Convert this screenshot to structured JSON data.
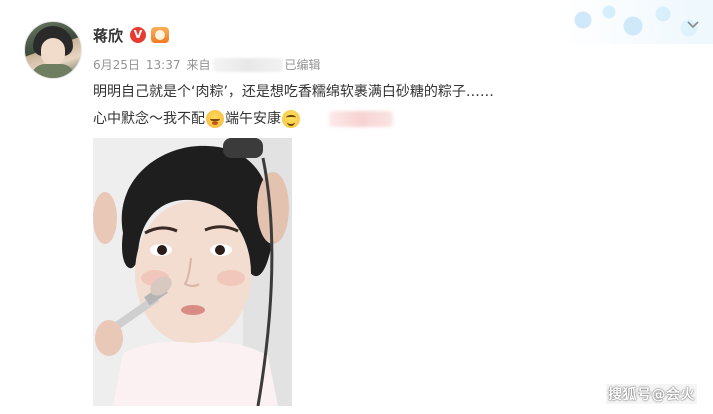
{
  "post": {
    "author": {
      "name": "蒋欣",
      "avatar_icon": "avatar-photo",
      "verified_badge": "V",
      "verified_icon": "verified-v-icon",
      "member_icon": "member-crown-icon"
    },
    "meta": {
      "date": "6月25日",
      "time": "13:37",
      "source_prefix": "来自",
      "source_suffix": "已编辑"
    },
    "text_line1": "明明自己就是个‘肉粽’，还是想吃香糯绵软裹满白砂糖的粽子……",
    "text_line2_part1": "心中默念～我不配",
    "text_line2_part2": "端午安康",
    "emoji1": "sad-face-emoji",
    "emoji2": "smile-face-emoji",
    "menu_icon": "chevron-down-icon",
    "photo_description_icon": "post-photo",
    "watermark": "搜狐号@会火"
  },
  "colors": {
    "text": "#333333",
    "meta": "#939393",
    "verified": "#e63b2e",
    "member": "#f07a1e"
  }
}
